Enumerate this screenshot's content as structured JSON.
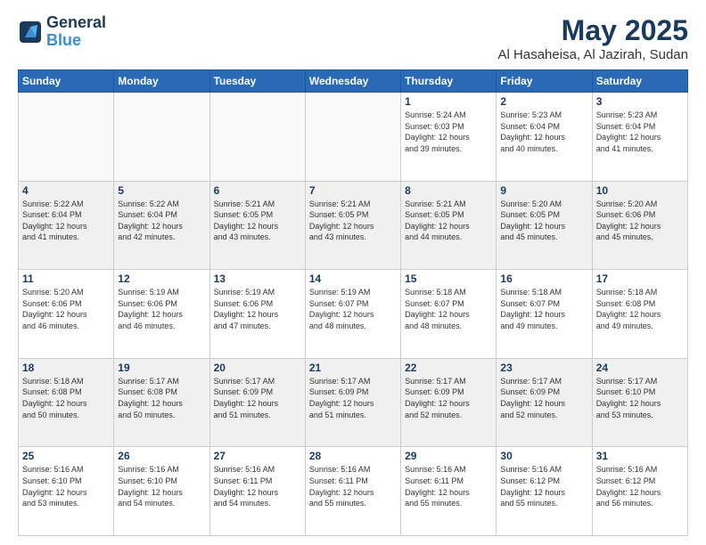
{
  "header": {
    "logo_line1": "General",
    "logo_line2": "Blue",
    "title": "May 2025",
    "subtitle": "Al Hasaheisa, Al Jazirah, Sudan"
  },
  "days_of_week": [
    "Sunday",
    "Monday",
    "Tuesday",
    "Wednesday",
    "Thursday",
    "Friday",
    "Saturday"
  ],
  "weeks": [
    [
      {
        "day": "",
        "empty": true
      },
      {
        "day": "",
        "empty": true
      },
      {
        "day": "",
        "empty": true
      },
      {
        "day": "",
        "empty": true
      },
      {
        "day": "1",
        "sunrise": "5:24 AM",
        "sunset": "6:03 PM",
        "daylight": "12 hours and 39 minutes."
      },
      {
        "day": "2",
        "sunrise": "5:23 AM",
        "sunset": "6:04 PM",
        "daylight": "12 hours and 40 minutes."
      },
      {
        "day": "3",
        "sunrise": "5:23 AM",
        "sunset": "6:04 PM",
        "daylight": "12 hours and 41 minutes."
      }
    ],
    [
      {
        "day": "4",
        "sunrise": "5:22 AM",
        "sunset": "6:04 PM",
        "daylight": "12 hours and 41 minutes."
      },
      {
        "day": "5",
        "sunrise": "5:22 AM",
        "sunset": "6:04 PM",
        "daylight": "12 hours and 42 minutes."
      },
      {
        "day": "6",
        "sunrise": "5:21 AM",
        "sunset": "6:05 PM",
        "daylight": "12 hours and 43 minutes."
      },
      {
        "day": "7",
        "sunrise": "5:21 AM",
        "sunset": "6:05 PM",
        "daylight": "12 hours and 43 minutes."
      },
      {
        "day": "8",
        "sunrise": "5:21 AM",
        "sunset": "6:05 PM",
        "daylight": "12 hours and 44 minutes."
      },
      {
        "day": "9",
        "sunrise": "5:20 AM",
        "sunset": "6:05 PM",
        "daylight": "12 hours and 45 minutes."
      },
      {
        "day": "10",
        "sunrise": "5:20 AM",
        "sunset": "6:06 PM",
        "daylight": "12 hours and 45 minutes."
      }
    ],
    [
      {
        "day": "11",
        "sunrise": "5:20 AM",
        "sunset": "6:06 PM",
        "daylight": "12 hours and 46 minutes."
      },
      {
        "day": "12",
        "sunrise": "5:19 AM",
        "sunset": "6:06 PM",
        "daylight": "12 hours and 46 minutes."
      },
      {
        "day": "13",
        "sunrise": "5:19 AM",
        "sunset": "6:06 PM",
        "daylight": "12 hours and 47 minutes."
      },
      {
        "day": "14",
        "sunrise": "5:19 AM",
        "sunset": "6:07 PM",
        "daylight": "12 hours and 48 minutes."
      },
      {
        "day": "15",
        "sunrise": "5:18 AM",
        "sunset": "6:07 PM",
        "daylight": "12 hours and 48 minutes."
      },
      {
        "day": "16",
        "sunrise": "5:18 AM",
        "sunset": "6:07 PM",
        "daylight": "12 hours and 49 minutes."
      },
      {
        "day": "17",
        "sunrise": "5:18 AM",
        "sunset": "6:08 PM",
        "daylight": "12 hours and 49 minutes."
      }
    ],
    [
      {
        "day": "18",
        "sunrise": "5:18 AM",
        "sunset": "6:08 PM",
        "daylight": "12 hours and 50 minutes."
      },
      {
        "day": "19",
        "sunrise": "5:17 AM",
        "sunset": "6:08 PM",
        "daylight": "12 hours and 50 minutes."
      },
      {
        "day": "20",
        "sunrise": "5:17 AM",
        "sunset": "6:09 PM",
        "daylight": "12 hours and 51 minutes."
      },
      {
        "day": "21",
        "sunrise": "5:17 AM",
        "sunset": "6:09 PM",
        "daylight": "12 hours and 51 minutes."
      },
      {
        "day": "22",
        "sunrise": "5:17 AM",
        "sunset": "6:09 PM",
        "daylight": "12 hours and 52 minutes."
      },
      {
        "day": "23",
        "sunrise": "5:17 AM",
        "sunset": "6:09 PM",
        "daylight": "12 hours and 52 minutes."
      },
      {
        "day": "24",
        "sunrise": "5:17 AM",
        "sunset": "6:10 PM",
        "daylight": "12 hours and 53 minutes."
      }
    ],
    [
      {
        "day": "25",
        "sunrise": "5:16 AM",
        "sunset": "6:10 PM",
        "daylight": "12 hours and 53 minutes."
      },
      {
        "day": "26",
        "sunrise": "5:16 AM",
        "sunset": "6:10 PM",
        "daylight": "12 hours and 54 minutes."
      },
      {
        "day": "27",
        "sunrise": "5:16 AM",
        "sunset": "6:11 PM",
        "daylight": "12 hours and 54 minutes."
      },
      {
        "day": "28",
        "sunrise": "5:16 AM",
        "sunset": "6:11 PM",
        "daylight": "12 hours and 55 minutes."
      },
      {
        "day": "29",
        "sunrise": "5:16 AM",
        "sunset": "6:11 PM",
        "daylight": "12 hours and 55 minutes."
      },
      {
        "day": "30",
        "sunrise": "5:16 AM",
        "sunset": "6:12 PM",
        "daylight": "12 hours and 55 minutes."
      },
      {
        "day": "31",
        "sunrise": "5:16 AM",
        "sunset": "6:12 PM",
        "daylight": "12 hours and 56 minutes."
      }
    ]
  ]
}
